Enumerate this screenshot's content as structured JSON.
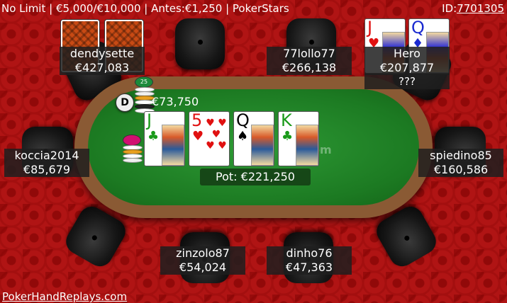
{
  "header": {
    "hand_info": "No Limit | €5,000/€10,000 | Antes:€1,250 | PokerStars",
    "id_label": "ID:",
    "id_value": "7701305"
  },
  "footer": {
    "site_link": "PokerHandReplays.com"
  },
  "watermark": "om",
  "players": {
    "dendysette": {
      "name": "dendysette",
      "stack": "€427,083"
    },
    "lollo": {
      "name": "77lollo77",
      "stack": "€266,138"
    },
    "hero": {
      "name": "Hero",
      "stack": "€207,877",
      "action": "???"
    },
    "koccia": {
      "name": "koccia2014",
      "stack": "€85,679"
    },
    "spiedino": {
      "name": "spiedino85",
      "stack": "€160,586"
    },
    "zinzolo": {
      "name": "zinzolo87",
      "stack": "€54,024"
    },
    "dinho": {
      "name": "dinho76",
      "stack": "€47,363"
    }
  },
  "hero_cards": [
    {
      "rank": "J",
      "suit": "♥"
    },
    {
      "rank": "Q",
      "suit": "♦"
    }
  ],
  "board": [
    {
      "rank": "J",
      "suit": "♣"
    },
    {
      "rank": "5",
      "suit": "♥"
    },
    {
      "rank": "Q",
      "suit": "♠"
    },
    {
      "rank": "K",
      "suit": "♣"
    }
  ],
  "dealer_button": "D",
  "bet": "€73,750",
  "chip_denomination": "25",
  "pot": "Pot: €221,250",
  "colors": {
    "background": "#b01414",
    "felt": "#1c7a22",
    "rail": "#8a5a34"
  }
}
